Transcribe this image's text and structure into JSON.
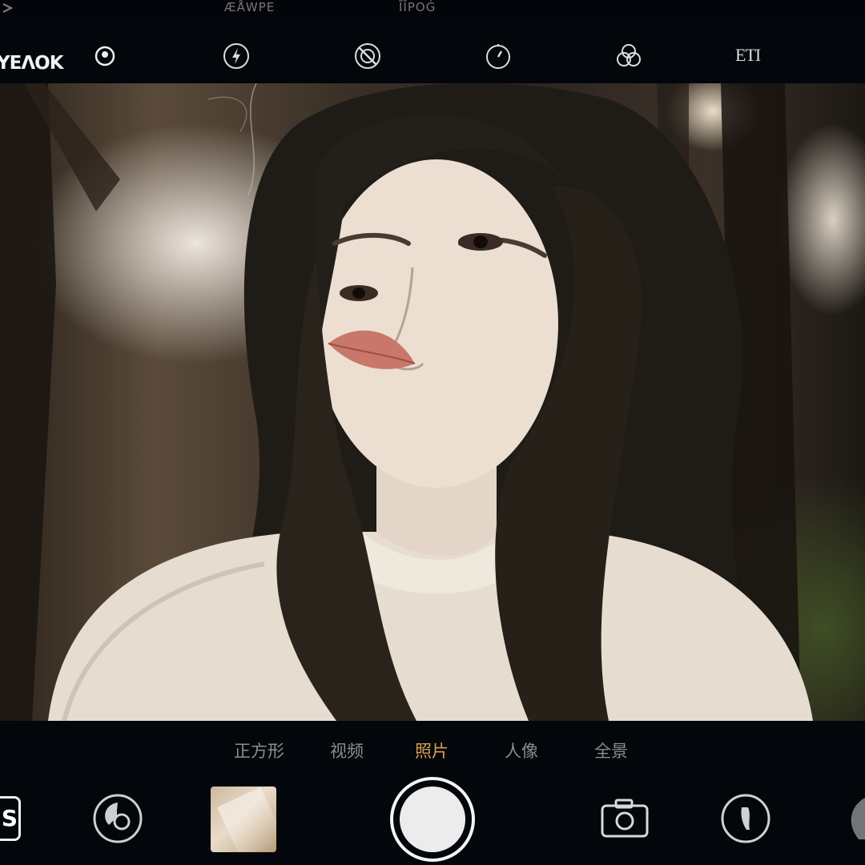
{
  "statusbar": {
    "left_text": "ÆÅWPE",
    "center_text": "ĪĪPOĠ"
  },
  "topbar": {
    "brand": "ΥΕΛΟΚ",
    "icons": [
      "eye-icon",
      "flash-icon",
      "live-off-icon",
      "timer-icon",
      "filter-icon",
      "raw-icon"
    ],
    "raw_label": "ETI"
  },
  "modes": {
    "items": [
      "正方形",
      "视频",
      "照片",
      "人像",
      "全景"
    ],
    "active": "照片",
    "active_color": "#d6a24e"
  },
  "controls": {
    "left_badge": "S",
    "icons": [
      "live-photo-icon",
      "last-photo-thumbnail",
      "shutter-button",
      "camera-switch-icon",
      "portrait-lighting-icon",
      "more-icon"
    ]
  },
  "viewfinder": {
    "subject": "portrait-photo"
  }
}
